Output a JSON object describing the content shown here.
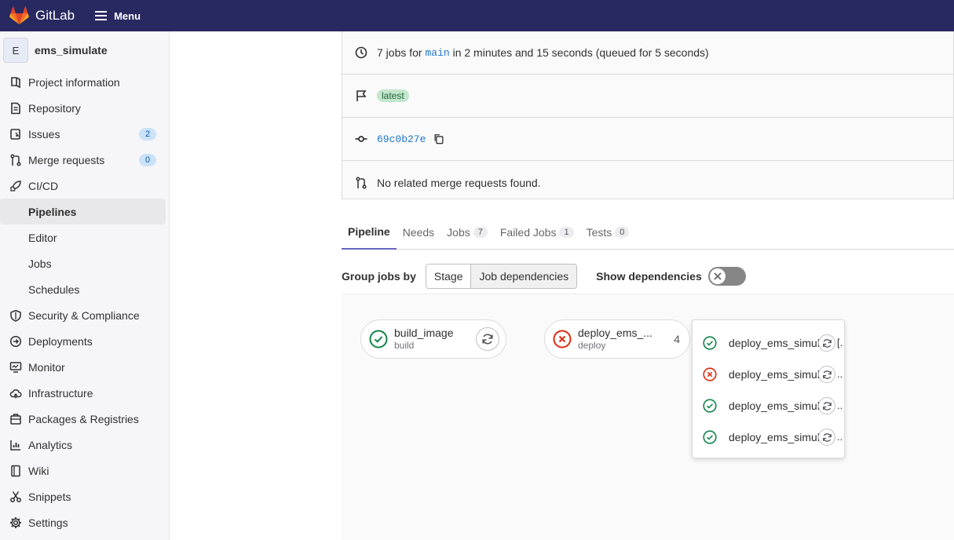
{
  "topbar": {
    "brand": "GitLab",
    "menu_label": "Menu"
  },
  "sidebar": {
    "project_initial": "E",
    "project_name": "ems_simulate",
    "items": [
      {
        "label": "Project information",
        "icon": "project-info-icon"
      },
      {
        "label": "Repository",
        "icon": "repository-icon"
      },
      {
        "label": "Issues",
        "icon": "issues-icon",
        "badge": "2"
      },
      {
        "label": "Merge requests",
        "icon": "merge-request-icon",
        "badge": "0"
      },
      {
        "label": "CI/CD",
        "icon": "rocket-icon"
      },
      {
        "label": "Pipelines",
        "sub": true,
        "active": true
      },
      {
        "label": "Editor",
        "sub": true
      },
      {
        "label": "Jobs",
        "sub": true
      },
      {
        "label": "Schedules",
        "sub": true
      },
      {
        "label": "Security & Compliance",
        "icon": "shield-icon"
      },
      {
        "label": "Deployments",
        "icon": "deployments-icon"
      },
      {
        "label": "Monitor",
        "icon": "monitor-icon"
      },
      {
        "label": "Infrastructure",
        "icon": "cloud-icon"
      },
      {
        "label": "Packages & Registries",
        "icon": "package-icon"
      },
      {
        "label": "Analytics",
        "icon": "chart-icon"
      },
      {
        "label": "Wiki",
        "icon": "book-icon"
      },
      {
        "label": "Snippets",
        "icon": "scissors-icon"
      },
      {
        "label": "Settings",
        "icon": "gear-icon"
      }
    ]
  },
  "pipeline_info": {
    "jobs_prefix": "7 jobs for",
    "branch": "main",
    "jobs_suffix": "in 2 minutes and 15 seconds (queued for 5 seconds)",
    "tag": "latest",
    "commit_sha": "69c0b27e",
    "merge_requests": "No related merge requests found."
  },
  "tabs": [
    {
      "label": "Pipeline",
      "active": true
    },
    {
      "label": "Needs"
    },
    {
      "label": "Jobs",
      "count": "7"
    },
    {
      "label": "Failed Jobs",
      "count": "1"
    },
    {
      "label": "Tests",
      "count": "0"
    }
  ],
  "group_by": {
    "label": "Group jobs by",
    "options": [
      "Stage",
      "Job dependencies"
    ],
    "selected": "Job dependencies",
    "show_dependencies_label": "Show dependencies",
    "show_dependencies": false
  },
  "graph": {
    "jobs": [
      {
        "name": "build_image",
        "stage": "build",
        "status": "success"
      },
      {
        "name": "deploy_ems_...",
        "stage": "deploy",
        "status": "failed",
        "count": "4"
      }
    ],
    "dropdown": [
      {
        "name": "deploy_ems_simul",
        "suffix": "[.",
        "status": "success"
      },
      {
        "name": "deploy_ems_simul",
        "suffix": "..",
        "status": "failed"
      },
      {
        "name": "deploy_ems_simul",
        "suffix": "..",
        "status": "success"
      },
      {
        "name": "deploy_ems_simul",
        "suffix": "..",
        "status": "success"
      }
    ]
  },
  "colors": {
    "topbar": "#292961",
    "success": "#108548",
    "failed": "#dd2b0e",
    "link": "#1f75cb",
    "tab_active": "#6666c4"
  }
}
